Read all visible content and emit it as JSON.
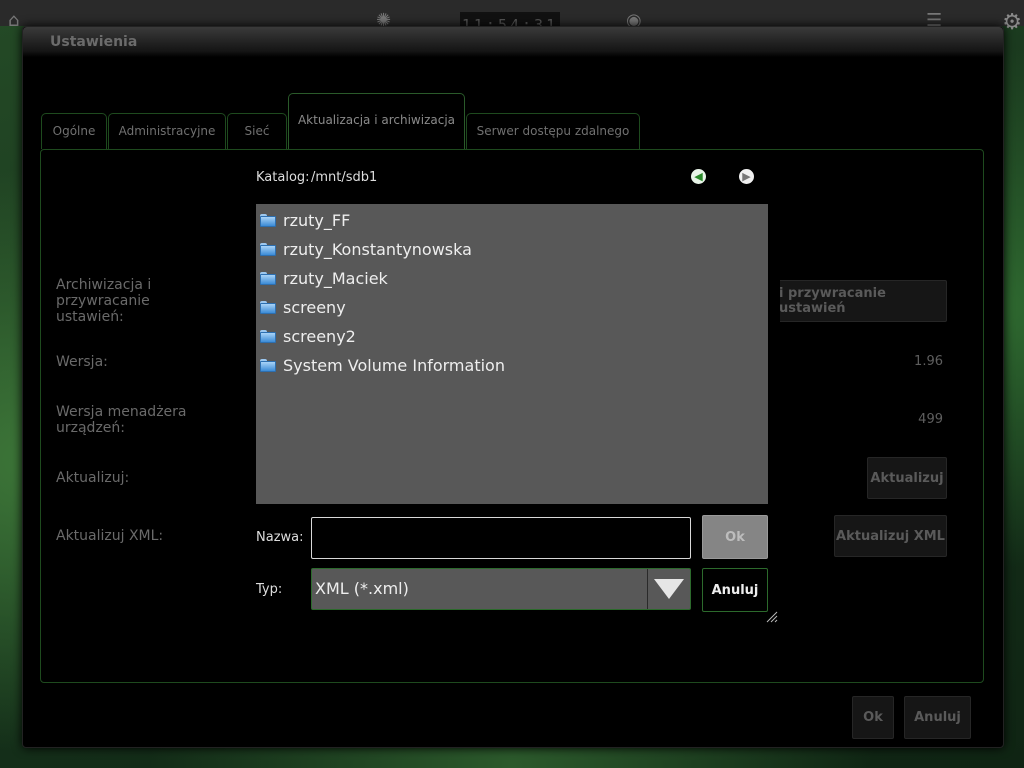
{
  "window": {
    "title": "Ustawienia"
  },
  "topbar": {
    "clock": "11:54:31"
  },
  "tabs": [
    {
      "label": "Ogólne"
    },
    {
      "label": "Administracyjne"
    },
    {
      "label": "Sieć"
    },
    {
      "label": "Aktualizacja i archiwizacja"
    },
    {
      "label": "Serwer dostępu zdalnego"
    }
  ],
  "settings": {
    "archive_label": "Archiwizacja i przywracanie ustawień:",
    "archive_button": "i przywracanie ustawień",
    "version_label": "Wersja:",
    "version_value": "1.96",
    "manager_version_label": "Wersja menadżera urządzeń:",
    "manager_version_value": "499",
    "update_label": "Aktualizuj:",
    "update_button": "Aktualizuj",
    "update_xml_label": "Aktualizuj XML:",
    "update_xml_button": "Aktualizuj XML"
  },
  "footer": {
    "ok": "Ok",
    "cancel": "Anuluj"
  },
  "file_dialog": {
    "directory_label": "Katalog:",
    "directory_path": "/mnt/sdb1",
    "files": [
      {
        "name": "rzuty_FF"
      },
      {
        "name": "rzuty_Konstantynowska"
      },
      {
        "name": "rzuty_Maciek"
      },
      {
        "name": "screeny"
      },
      {
        "name": "screeny2"
      },
      {
        "name": "System Volume Information"
      }
    ],
    "name_label": "Nazwa:",
    "name_value": "",
    "type_label": "Typ:",
    "type_value": "XML (*.xml)",
    "ok": "Ok",
    "cancel": "Anuluj"
  },
  "colors": {
    "accent": "#2c6a2c",
    "list_bg": "#585858"
  }
}
